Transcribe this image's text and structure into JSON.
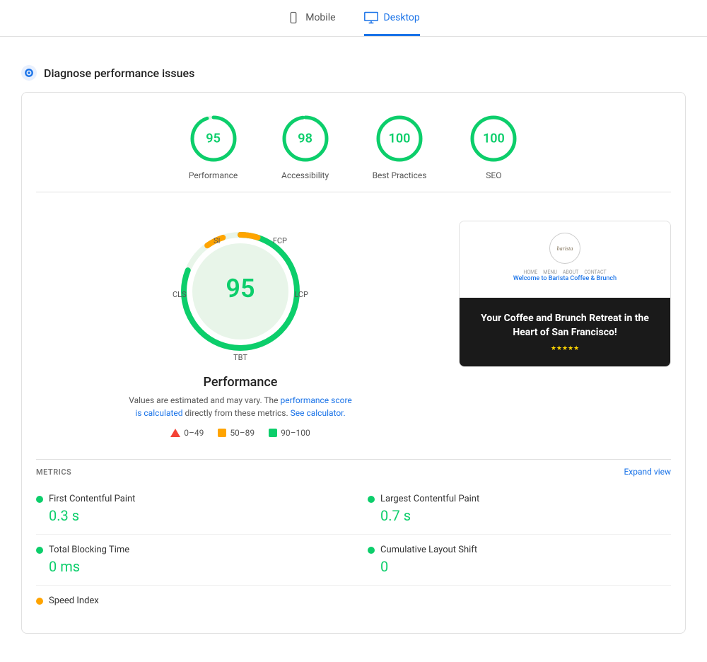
{
  "nav": {
    "tabs": [
      {
        "id": "mobile",
        "label": "Mobile",
        "active": false
      },
      {
        "id": "desktop",
        "label": "Desktop",
        "active": true
      }
    ]
  },
  "diagnose": {
    "title": "Diagnose performance issues"
  },
  "scores": [
    {
      "id": "performance",
      "value": "95",
      "label": "Performance",
      "pct": 95
    },
    {
      "id": "accessibility",
      "value": "98",
      "label": "Accessibility",
      "pct": 98
    },
    {
      "id": "best-practices",
      "value": "100",
      "label": "Best Practices",
      "pct": 100
    },
    {
      "id": "seo",
      "value": "100",
      "label": "SEO",
      "pct": 100
    }
  ],
  "gauge": {
    "center_value": "95",
    "title": "Performance",
    "note_part1": "Values are estimated and may vary. The",
    "note_link1": "performance score is calculated",
    "note_part2": "directly from these metrics.",
    "note_link2": "See calculator.",
    "labels": {
      "si": "SI",
      "fcp": "FCP",
      "cls": "CLS",
      "lcp": "LCP",
      "tbt": "TBT"
    }
  },
  "legend": [
    {
      "id": "bad",
      "range": "0–49",
      "type": "triangle",
      "color": "#f44336"
    },
    {
      "id": "average",
      "range": "50–89",
      "type": "square",
      "color": "#ffa400"
    },
    {
      "id": "good",
      "range": "90–100",
      "type": "circle",
      "color": "#0cce6b"
    }
  ],
  "preview": {
    "barista_text": "barista",
    "nav_items": [
      "HOME",
      "MENU",
      "ABOUT",
      "CONTACT"
    ],
    "welcome_text": "Welcome to Barista Coffee & Brunch",
    "headline": "Your Coffee and Brunch Retreat in the Heart of San Francisco!",
    "sub_icons": "★★★★★"
  },
  "metrics": {
    "section_label": "METRICS",
    "expand_label": "Expand view",
    "items": [
      {
        "id": "fcp",
        "name": "First Contentful Paint",
        "value": "0.3 s",
        "color": "green"
      },
      {
        "id": "lcp",
        "name": "Largest Contentful Paint",
        "value": "0.7 s",
        "color": "green"
      },
      {
        "id": "tbt",
        "name": "Total Blocking Time",
        "value": "0 ms",
        "color": "green"
      },
      {
        "id": "cls",
        "name": "Cumulative Layout Shift",
        "value": "0",
        "color": "green"
      },
      {
        "id": "si",
        "name": "Speed Index",
        "value": "",
        "color": "orange"
      }
    ]
  }
}
